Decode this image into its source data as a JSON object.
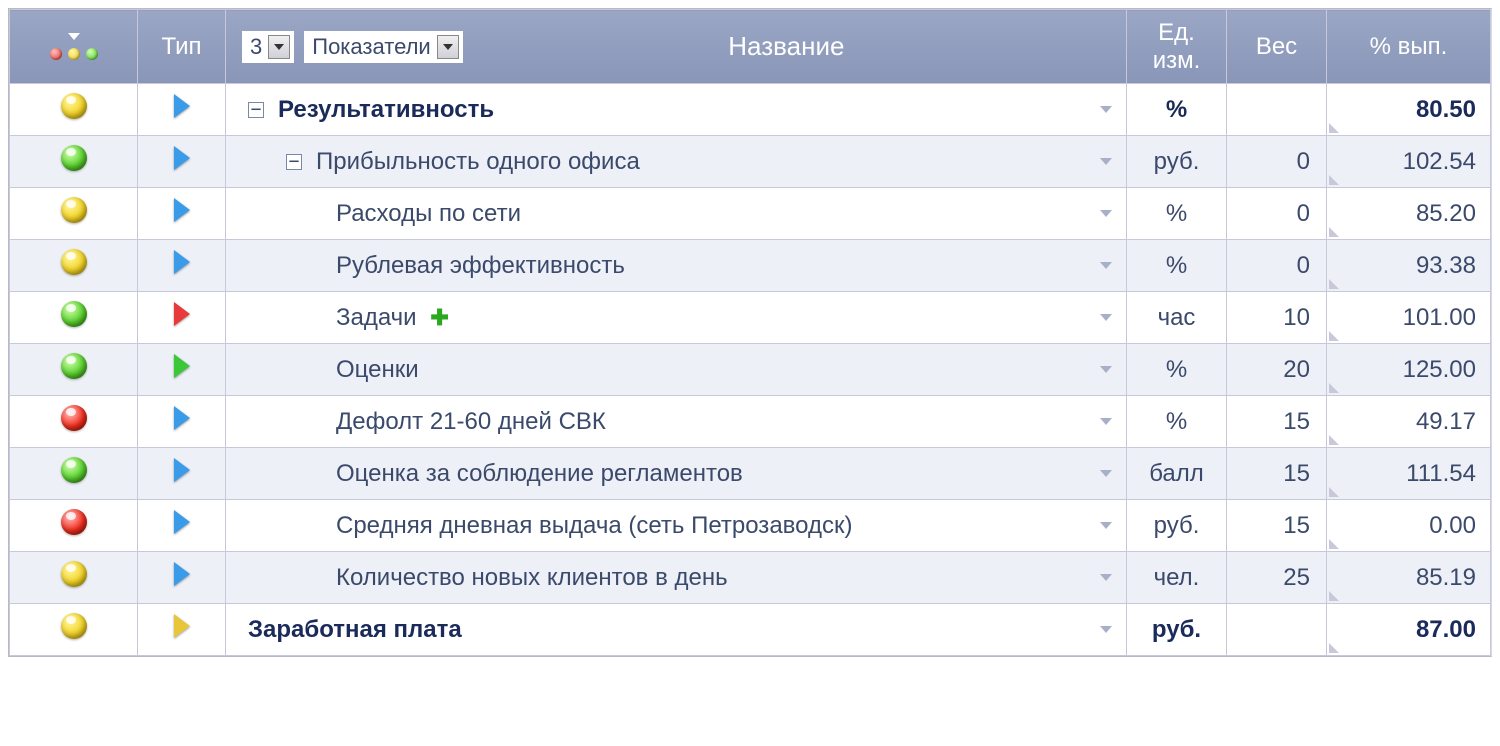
{
  "header": {
    "type": "Тип",
    "name": "Название",
    "unit": "Ед. изм.",
    "weight": "Вес",
    "pct": "% вып.",
    "level_select": "3",
    "view_select": "Показатели"
  },
  "rows": [
    {
      "status": "yellow",
      "type": "blue",
      "indent": 0,
      "bold": true,
      "expand": "-",
      "plus": false,
      "name": "Результативность",
      "unit": "%",
      "weight": "",
      "pct": "80.50"
    },
    {
      "status": "green",
      "type": "blue",
      "indent": 1,
      "bold": false,
      "expand": "-",
      "plus": false,
      "name": "Прибыльность одного офиса",
      "unit": "руб.",
      "weight": "0",
      "pct": "102.54"
    },
    {
      "status": "yellow",
      "type": "blue",
      "indent": 2,
      "bold": false,
      "expand": null,
      "plus": false,
      "name": "Расходы по сети",
      "unit": "%",
      "weight": "0",
      "pct": "85.20"
    },
    {
      "status": "yellow",
      "type": "blue",
      "indent": 2,
      "bold": false,
      "expand": null,
      "plus": false,
      "name": "Рублевая эффективность",
      "unit": "%",
      "weight": "0",
      "pct": "93.38"
    },
    {
      "status": "green",
      "type": "red",
      "indent": 2,
      "bold": false,
      "expand": null,
      "plus": true,
      "name": "Задачи",
      "unit": "час",
      "weight": "10",
      "pct": "101.00"
    },
    {
      "status": "green",
      "type": "green",
      "indent": 2,
      "bold": false,
      "expand": null,
      "plus": false,
      "name": "Оценки",
      "unit": "%",
      "weight": "20",
      "pct": "125.00"
    },
    {
      "status": "red",
      "type": "blue",
      "indent": 2,
      "bold": false,
      "expand": null,
      "plus": false,
      "name": "Дефолт 21-60 дней СВК",
      "unit": "%",
      "weight": "15",
      "pct": "49.17"
    },
    {
      "status": "green",
      "type": "blue",
      "indent": 2,
      "bold": false,
      "expand": null,
      "plus": false,
      "name": "Оценка за соблюдение регламентов",
      "unit": "балл",
      "weight": "15",
      "pct": "111.54"
    },
    {
      "status": "red",
      "type": "blue",
      "indent": 2,
      "bold": false,
      "expand": null,
      "plus": false,
      "name": "Средняя дневная выдача (сеть Петрозаводск)",
      "unit": "руб.",
      "weight": "15",
      "pct": "0.00"
    },
    {
      "status": "yellow",
      "type": "blue",
      "indent": 2,
      "bold": false,
      "expand": null,
      "plus": false,
      "name": "Количество новых клиентов в день",
      "unit": "чел.",
      "weight": "25",
      "pct": "85.19"
    },
    {
      "status": "yellow",
      "type": "yellow",
      "indent": 0,
      "bold": true,
      "expand": null,
      "plus": false,
      "name": "Заработная плата",
      "unit": "руб.",
      "weight": "",
      "pct": "87.00"
    }
  ]
}
